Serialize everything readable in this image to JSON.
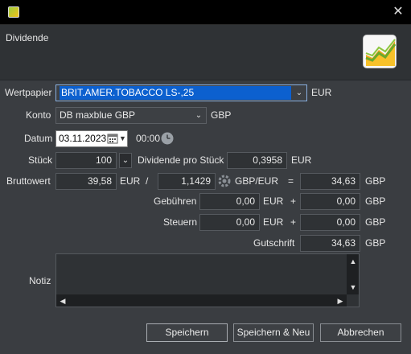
{
  "window": {
    "title": "",
    "close_glyph": "✕"
  },
  "header": {
    "title": "Dividende",
    "logo_icon": "chart-logo-icon"
  },
  "wertpapier": {
    "label": "Wertpapier",
    "value": "BRIT.AMER.TOBACCO  LS-,25",
    "currency": "EUR"
  },
  "konto": {
    "label": "Konto",
    "value": "DB maxblue GBP",
    "currency": "GBP"
  },
  "datum": {
    "label": "Datum",
    "date": "03.11.2023",
    "time": "00:00"
  },
  "stueck": {
    "label": "Stück",
    "value": "100",
    "dividende_label": "Dividende pro Stück",
    "dividende_value": "0,3958",
    "dividende_currency": "EUR"
  },
  "brutto": {
    "label": "Bruttowert",
    "value": "39,58",
    "currency": "EUR",
    "divider": "/",
    "rate": "1,1429",
    "rate_label": "GBP/EUR",
    "equals": "=",
    "result": "34,63",
    "result_currency": "GBP"
  },
  "gebuehren": {
    "label": "Gebühren",
    "value": "0,00",
    "currency": "EUR",
    "plus": "+",
    "result": "0,00",
    "result_currency": "GBP"
  },
  "steuern": {
    "label": "Steuern",
    "value": "0,00",
    "currency": "EUR",
    "plus": "+",
    "result": "0,00",
    "result_currency": "GBP"
  },
  "gutschrift": {
    "label": "Gutschrift",
    "value": "34,63",
    "currency": "GBP"
  },
  "notiz": {
    "label": "Notiz",
    "value": ""
  },
  "buttons": {
    "save": "Speichern",
    "save_new": "Speichern & Neu",
    "cancel": "Abbrechen"
  },
  "colors": {
    "accent": "#0c60cf",
    "background": "#3a3d41",
    "field": "#2f3235",
    "titlebar": "#000000"
  }
}
